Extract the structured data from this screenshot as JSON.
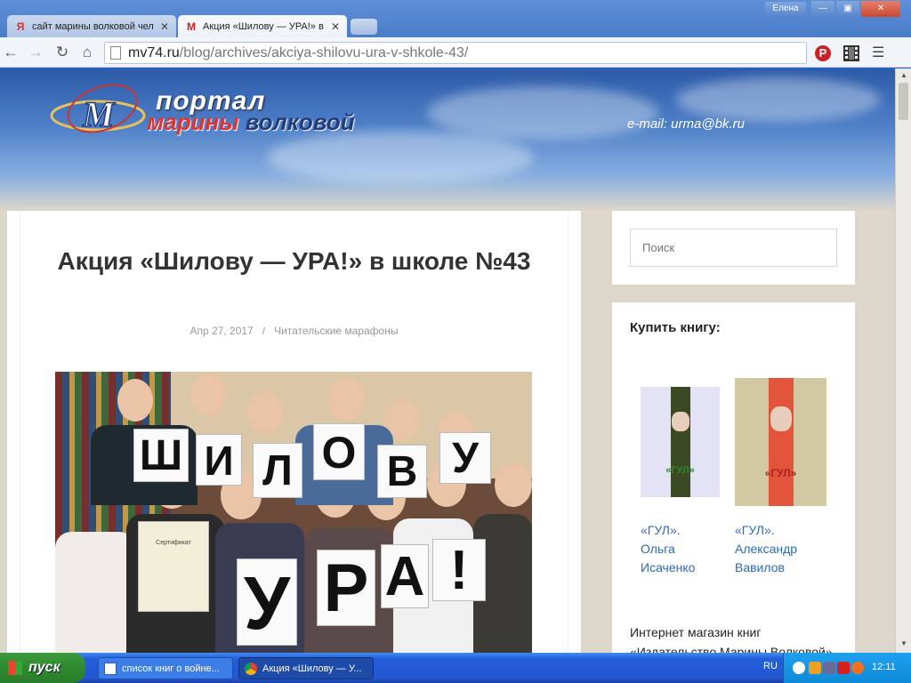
{
  "browser": {
    "tabs": [
      {
        "favicon": "Я",
        "title": "сайт марины волковой чел"
      },
      {
        "favicon": "M",
        "title": "Акция «Шилову — УРА!» в"
      }
    ],
    "user_name": "Елена",
    "url_host": "mv74.ru",
    "url_path": "/blog/archives/akciya-shilovu-ura-v-shkole-43/"
  },
  "header": {
    "logo_line1": "портал",
    "logo_line2_a": "марины",
    "logo_line2_b": " волковой",
    "email": "e-mail: urma@bk.ru"
  },
  "post": {
    "title": "Акция «Шилову — УРА!» в школе №43",
    "date": "Апр 27, 2017",
    "separator": "/",
    "category": "Читательские марафоны",
    "sign_letters_top": [
      "Ш",
      "И",
      "Л",
      "О",
      "В",
      "У"
    ],
    "sign_letters_bottom": [
      "У",
      "Р",
      "А",
      "!"
    ],
    "certificate_text": "Сертификат"
  },
  "sidebar": {
    "search_placeholder": "Поиск",
    "books_title": "Купить книгу:",
    "books": [
      {
        "line1": "«ГУЛ».",
        "line2": "Ольга",
        "line3": "Исаченко",
        "cover_label": "«ГУЛ»"
      },
      {
        "line1": "«ГУЛ».",
        "line2": "Александр",
        "line3": "Вавилов",
        "cover_label": "«ГУЛ»"
      }
    ],
    "shop_line1": "Интернет магазин книг",
    "shop_line2": "«Издательство Марины Волковой»"
  },
  "taskbar": {
    "start_label": "пуск",
    "tasks": [
      {
        "label": "список книг о войне..."
      },
      {
        "label": "Акция «Шилову — У..."
      }
    ],
    "language": "RU",
    "clock": "12:11"
  },
  "colors": {
    "accent_link": "#2d6ab3",
    "logo_red": "#d33",
    "pinterest": "#cb2027"
  }
}
